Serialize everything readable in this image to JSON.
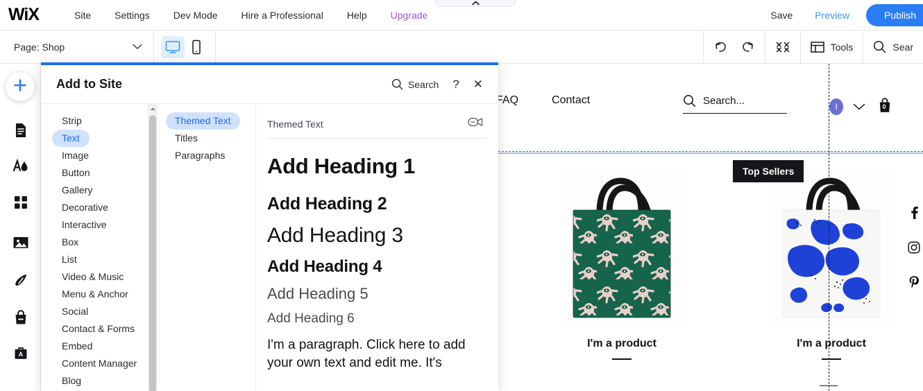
{
  "topbar": {
    "logo": "WiX",
    "nav": [
      "Site",
      "Settings",
      "Dev Mode",
      "Hire a Professional",
      "Help",
      "Upgrade"
    ],
    "save_label": "Save",
    "preview_label": "Preview",
    "publish_label": "Publish",
    "collapse_icon": "chevron-up-icon"
  },
  "secondbar": {
    "page_label": "Page:",
    "page_name": "Shop",
    "page_chevron_icon": "chevron-down-icon",
    "desktop_icon": "monitor-icon",
    "mobile_icon": "phone-icon",
    "undo_icon": "undo-icon",
    "redo_icon": "redo-icon",
    "zoomout_icon": "zoom-out-icon",
    "tools_label": "Tools",
    "tools_icon": "layout-panel-icon",
    "search_label": "Sear",
    "search_icon": "search-icon"
  },
  "leftrail": {
    "add_icon": "plus-icon",
    "items": [
      {
        "icon": "pages-icon",
        "name": "pages"
      },
      {
        "icon": "design-icon",
        "name": "design"
      },
      {
        "icon": "apps-icon",
        "name": "apps"
      },
      {
        "icon": "media-icon",
        "name": "media"
      },
      {
        "icon": "blog-pen-icon",
        "name": "blog"
      },
      {
        "icon": "store-bag-icon",
        "name": "store"
      },
      {
        "icon": "bookings-icon",
        "name": "bookings"
      }
    ]
  },
  "panel": {
    "title": "Add to Site",
    "search_label": "Search",
    "search_icon": "search-icon",
    "help_label": "?",
    "close_label": "✕",
    "categories": [
      "Strip",
      "Text",
      "Image",
      "Button",
      "Gallery",
      "Decorative",
      "Interactive",
      "Box",
      "List",
      "Video & Music",
      "Menu & Anchor",
      "Social",
      "Contact & Forms",
      "Embed",
      "Content Manager",
      "Blog"
    ],
    "active_category": "Text",
    "subcategories": [
      "Themed Text",
      "Titles",
      "Paragraphs"
    ],
    "active_subcategory": "Themed Text",
    "section_title": "Themed Text",
    "section_video_icon": "video-icon",
    "samples": {
      "h1": "Add Heading 1",
      "h2": "Add Heading 2",
      "h3": "Add Heading 3",
      "h4": "Add Heading 4",
      "h5": "Add Heading 5",
      "h6": "Add Heading 6",
      "paragraph": "I'm a paragraph. Click here to add your own text and edit me. It's"
    },
    "accent_color": "#1e6cf0",
    "highlight_bg": "#cfe1fc"
  },
  "canvas": {
    "nav_links": [
      "FAQ",
      "Contact"
    ],
    "search_placeholder": "Search...",
    "search_icon": "search-icon",
    "avatar_initial": "I",
    "avatar_chevron_icon": "chevron-down-icon",
    "cart_icon": "shopping-bag-icon",
    "cart_count": "0",
    "tooltip": "Top Sellers",
    "products": [
      {
        "caption": "I'm a product",
        "name": "green-eye-hands-tote"
      },
      {
        "caption": "I'm a product",
        "name": "blue-abstract-tote"
      }
    ],
    "social": [
      {
        "icon": "facebook-icon",
        "glyph": "f"
      },
      {
        "icon": "instagram-icon",
        "glyph": ""
      },
      {
        "icon": "pinterest-icon",
        "glyph": "р"
      }
    ]
  }
}
